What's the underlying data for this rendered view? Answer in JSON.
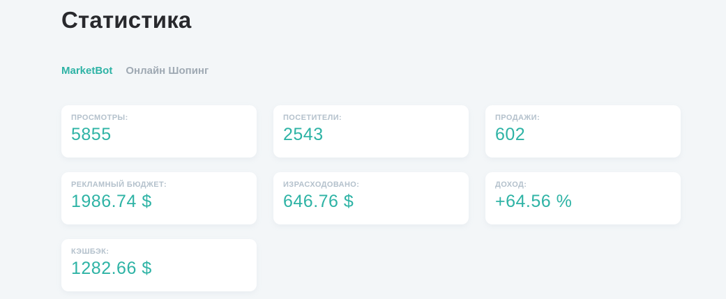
{
  "page": {
    "title": "Статистика"
  },
  "tabs": [
    {
      "label": "MarketBot",
      "active": true
    },
    {
      "label": "Онлайн Шопинг",
      "active": false
    }
  ],
  "cards": [
    {
      "label": "ПРОСМОТРЫ:",
      "value": "5855"
    },
    {
      "label": "ПОСЕТИТЕЛИ:",
      "value": "2543"
    },
    {
      "label": "ПРОДАЖИ:",
      "value": "602"
    },
    {
      "label": "РЕКЛАМНЫЙ БЮДЖЕТ:",
      "value": "1986.74 $"
    },
    {
      "label": "ИЗРАСХОДОВАНО:",
      "value": "646.76 $"
    },
    {
      "label": "ДОХОД:",
      "value": "+64.56 %"
    },
    {
      "label": "КЭШБЭК:",
      "value": "1282.66 $"
    }
  ],
  "colors": {
    "accent": "#2eb3a5",
    "label": "#b4c1cc",
    "background": "#f3f6f8",
    "card": "#ffffff",
    "title": "#28292d",
    "tab_inactive": "#9fa9b3"
  }
}
